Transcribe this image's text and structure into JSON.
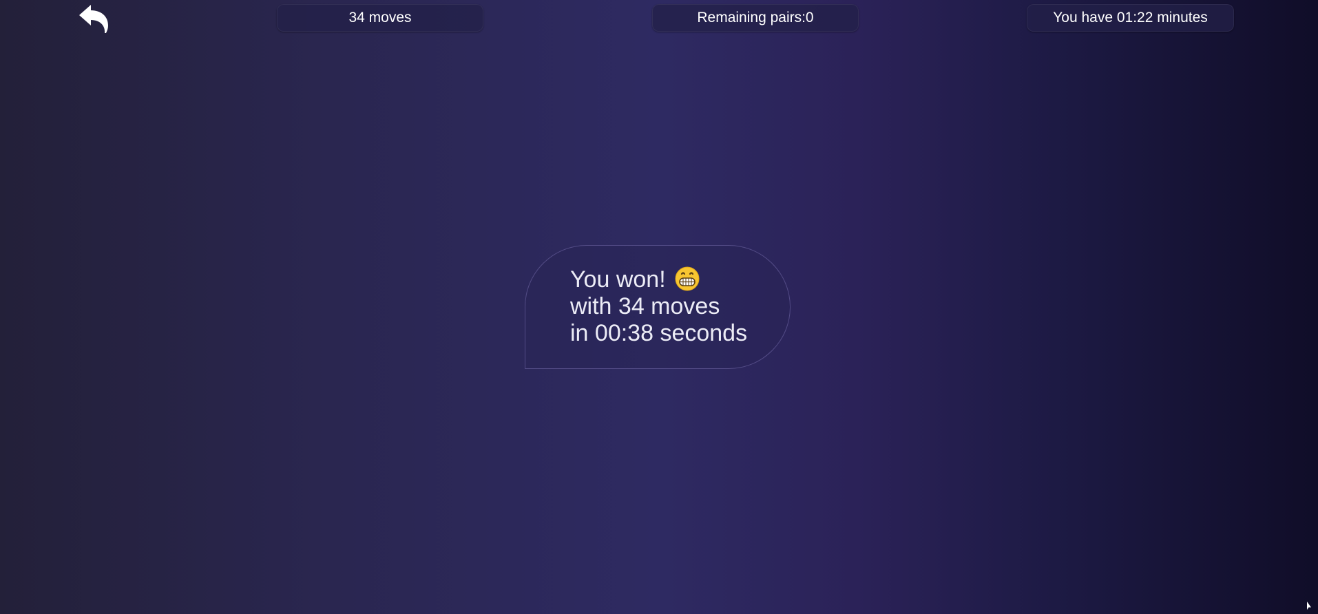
{
  "header": {
    "back_icon": "undo-arrow-icon",
    "moves_label": "34 moves",
    "pairs_label": "Remaining pairs:0",
    "timer_label": "You have 01:22 minutes"
  },
  "result": {
    "line1": "You won!",
    "emoji_icon": "grinning-face-icon",
    "line2": "with 34 moves",
    "line3": "in 00:38 seconds"
  },
  "colors": {
    "background_start": "#232039",
    "background_mid": "#2e2a62",
    "background_end": "#100d28",
    "text": "#ffffff"
  }
}
